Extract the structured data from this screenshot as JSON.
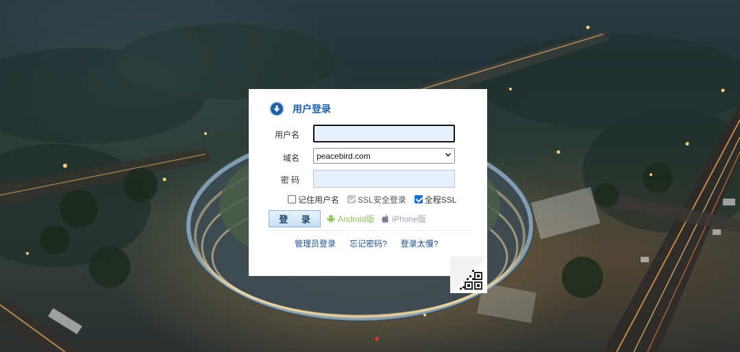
{
  "login": {
    "title": "用户登录",
    "username_label": "用户名",
    "username_value": "",
    "domain_label": "域名",
    "domain_value": "peacebird.com",
    "password_label": "密 码",
    "password_value": "",
    "remember_label": "记住用户名",
    "remember_checked": false,
    "ssl_label": "SSL安全登录",
    "ssl_checked": true,
    "full_ssl_label": "全程SSL",
    "full_ssl_checked": true,
    "login_button": "登 录",
    "android_label": "Android版",
    "iphone_label": "iPhone版"
  },
  "links": {
    "admin_login": "管理员登录",
    "forgot_password": "忘记密码?",
    "slow_login": "登录太慢?"
  },
  "icons": {
    "header": "download-circle-icon",
    "android": "android-icon",
    "apple": "apple-icon",
    "qr": "qr-code-icon",
    "select": "chevron-down-icon"
  },
  "colors": {
    "accent": "#1e5fa8",
    "android": "#8dbf5a",
    "link": "#1e4f86"
  }
}
